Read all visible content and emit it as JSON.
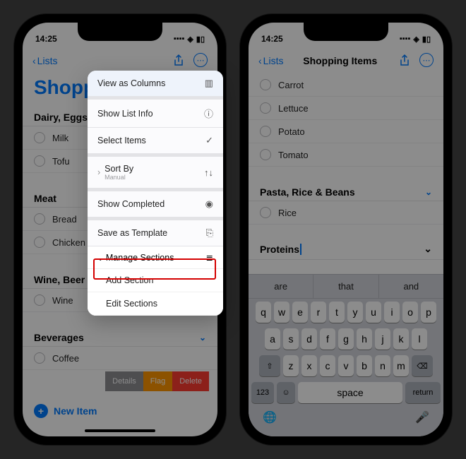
{
  "left": {
    "status": {
      "time": "14:25",
      "signal": "••••",
      "wifi": "◉",
      "battery": "▮▯"
    },
    "nav": {
      "back": "Lists"
    },
    "title": "Shoppi",
    "sections": [
      {
        "name": "Dairy, Eggs &",
        "items": [
          "Milk",
          "Tofu"
        ]
      },
      {
        "name": "Meat",
        "items": [
          "Bread",
          "Chicken"
        ]
      },
      {
        "name": "Wine, Beer & Spirits",
        "items": [
          "Wine"
        ]
      },
      {
        "name": "Beverages",
        "items": [
          "Coffee"
        ]
      }
    ],
    "swipe": {
      "details": "Details",
      "flag": "Flag",
      "delete": "Delete"
    },
    "newItem": "New Item",
    "menu": {
      "viewColumns": "View as Columns",
      "showInfo": "Show List Info",
      "selectItems": "Select Items",
      "sortBy": "Sort By",
      "sortByValue": "Manual",
      "showCompleted": "Show Completed",
      "saveTemplate": "Save as Template",
      "manageSections": "Manage Sections",
      "addSection": "Add Section",
      "editSections": "Edit Sections"
    }
  },
  "right": {
    "status": {
      "time": "14:25"
    },
    "nav": {
      "back": "Lists",
      "title": "Shopping Items"
    },
    "sections": [
      {
        "name": "",
        "items": [
          "Carrot",
          "Lettuce",
          "Potato",
          "Tomato"
        ]
      },
      {
        "name": "Pasta, Rice & Beans",
        "items": [
          "Rice"
        ]
      }
    ],
    "newSection": "Proteins",
    "keyboard": {
      "suggestions": [
        "are",
        "that",
        "and"
      ],
      "row1": [
        "q",
        "w",
        "e",
        "r",
        "t",
        "y",
        "u",
        "i",
        "o",
        "p"
      ],
      "row2": [
        "a",
        "s",
        "d",
        "f",
        "g",
        "h",
        "j",
        "k",
        "l"
      ],
      "row3": [
        "z",
        "x",
        "c",
        "v",
        "b",
        "n",
        "m"
      ],
      "shift": "⇧",
      "backspace": "⌫",
      "numKey": "123",
      "emoji": "☺",
      "space": "space",
      "return": "return",
      "globe": "🌐",
      "mic": "🎤"
    }
  }
}
